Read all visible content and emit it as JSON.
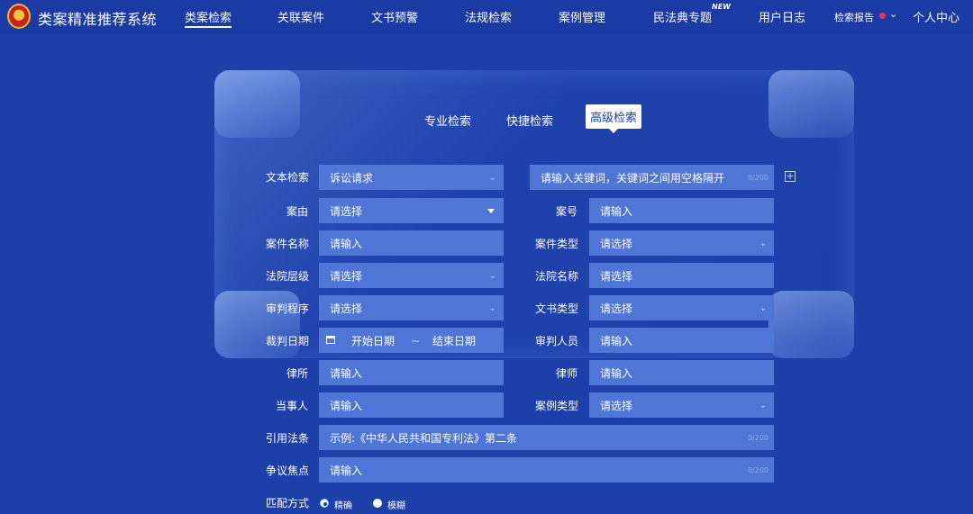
{
  "header": {
    "app_title": "类案精准推荐系统",
    "nav": [
      "类案检索",
      "关联案件",
      "文书预警",
      "法规检索",
      "案例管理",
      "民法典专题",
      "用户日志"
    ],
    "new_badge": "NEW",
    "report": "检索报告",
    "user_center": "个人中心"
  },
  "tabs": [
    "专业检索",
    "快捷检索",
    "高级检索"
  ],
  "form": {
    "text_search_label": "文本检索",
    "text_search_scope": "诉讼请求",
    "keyword_placeholder": "请输入关键词，关键词之间用空格隔开",
    "keyword_counter": "0/200",
    "cause_label": "案由",
    "cause_value": "请选择",
    "case_no_label": "案号",
    "case_no_value": "请输入",
    "case_name_label": "案件名称",
    "case_name_value": "请输入",
    "case_type_label": "案件类型",
    "case_type_value": "请选择",
    "court_level_label": "法院层级",
    "court_level_value": "请选择",
    "court_name_label": "法院名称",
    "court_name_value": "请选择",
    "procedure_label": "审判程序",
    "procedure_value": "请选择",
    "doc_type_label": "文书类型",
    "doc_type_value": "请选择",
    "judge_date_label": "裁判日期",
    "start_date": "开始日期",
    "date_sep": "~",
    "end_date": "结束日期",
    "judge_person_label": "审判人员",
    "judge_person_value": "请输入",
    "law_firm_label": "律所",
    "law_firm_value": "请输入",
    "lawyer_label": "律师",
    "lawyer_value": "请输入",
    "party_label": "当事人",
    "party_value": "请输入",
    "example_type_label": "案例类型",
    "example_type_value": "请选择",
    "cited_law_label": "引用法条",
    "cited_law_placeholder": "示例:《中华人民共和国专利法》第二条",
    "cited_law_counter": "0/200",
    "dispute_label": "争议焦点",
    "dispute_value": "请输入",
    "dispute_counter": "0/200",
    "match_label": "匹配方式",
    "match_exact": "精确",
    "match_fuzzy": "模糊"
  },
  "icons": [
    "logo-emblem-icon",
    "chevron-down-icon",
    "caret-down-icon",
    "calendar-icon",
    "plus-square-icon"
  ],
  "colors": {
    "background": "#1d3fa8",
    "field": "#4f76d6",
    "accent_dot": "#e0345a"
  }
}
